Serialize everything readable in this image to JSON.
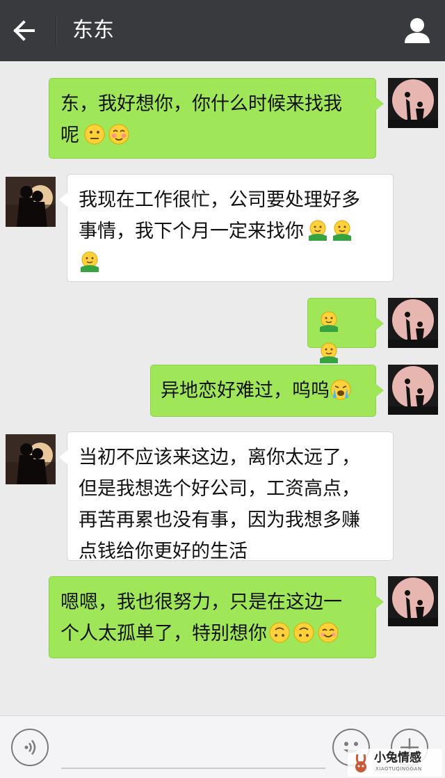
{
  "header": {
    "title": "东东",
    "back_icon": "back-arrow-icon",
    "profile_icon": "person-icon",
    "bg_color": "#393a3e"
  },
  "messages": [
    {
      "from": "me",
      "text": [
        "东，我好想你，你什么时候来找我",
        "呢"
      ],
      "emojis": [
        "neutral-face",
        "blush-face"
      ]
    },
    {
      "from": "other",
      "text": [
        "我现在工作很忙，公司要处理好多",
        "事情，我下个月一定来找你"
      ],
      "emojis": [
        "hug-face",
        "hug-face",
        "hug-face"
      ]
    },
    {
      "from": "me",
      "text": [],
      "emojis": [
        "hug-face",
        "hug-face"
      ]
    },
    {
      "from": "me",
      "text": [
        "异地恋好难过，呜呜"
      ],
      "emojis": [
        "crying-face"
      ]
    },
    {
      "from": "other",
      "text": [
        "当初不应该来这边，离你太远了，",
        "但是我想选个好公司，工资高点，",
        "再苦再累也没有事，因为我想多赚",
        "点钱给你更好的生活"
      ],
      "emojis": []
    },
    {
      "from": "me",
      "text": [
        "嗯嗯，我也很努力，只是在这边一",
        "个人太孤单了，特别想你"
      ],
      "emojis": [
        "upside-down-face",
        "upside-down-face",
        "smiling-face"
      ]
    }
  ],
  "input_bar": {
    "voice_icon": "voice-icon",
    "emoji_icon": "emoji-face-icon",
    "add_icon": "plus-icon"
  },
  "watermark": {
    "text": "小兔情感",
    "sub": "XIAOTUQINGGAN"
  },
  "colors": {
    "my_bubble": "#9fe658",
    "other_bubble": "#ffffff",
    "chat_bg": "#ebebeb"
  }
}
